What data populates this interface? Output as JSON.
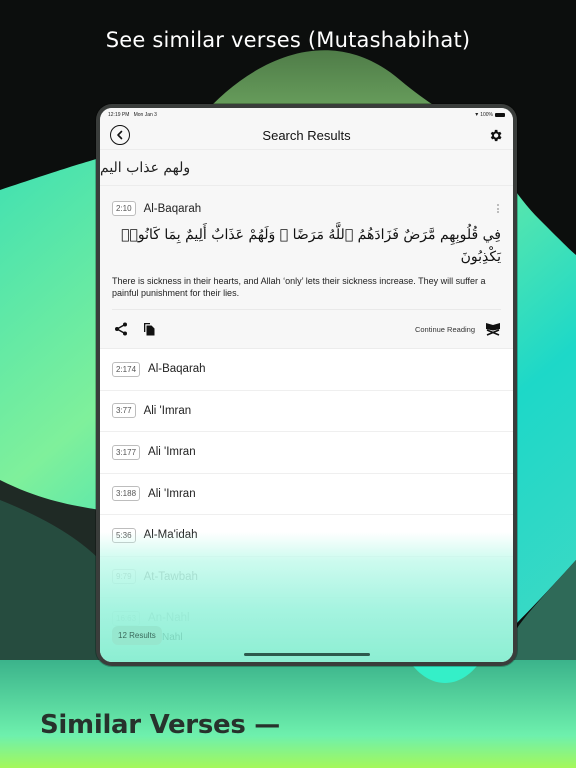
{
  "promo": {
    "title": "See similar verses (Mutashabihat)",
    "footer": "Similar Verses —"
  },
  "colors": {
    "background_dark": "#0c0e0d",
    "accent_mint": "#5ce8b8",
    "accent_teal": "#1fd6c0",
    "accent_lime": "#9cf75c",
    "footer_text": "#27322c"
  },
  "statusbar": {
    "time": "12:19 PM",
    "date": "Mon Jan 3",
    "battery": "100%",
    "wifi_icon": "wifi-icon",
    "battery_icon": "battery-icon"
  },
  "navbar": {
    "title": "Search Results",
    "back_icon": "chevron-left-circle-icon",
    "settings_icon": "gear-icon"
  },
  "query": {
    "text": "ولهم عذاب اليم"
  },
  "selected_verse": {
    "ref": "2:10",
    "surah": "Al-Baqarah",
    "arabic": "فِي قُلُوبِهِم مَّرَضٌ فَزَادَهُمُ ٱللَّهُ مَرَضًا ۖ وَلَهُمْ عَذَابٌ أَلِيمٌ بِمَا كَانُوا۟ يَكْذِبُونَ",
    "translation": "There is sickness in their hearts, and Allah ‘only’ lets their sickness increase. They will suffer a painful punishment for their lies.",
    "actions": {
      "share_icon": "share-icon",
      "copy_icon": "copy-icon",
      "continue_label": "Continue Reading",
      "continue_icon": "quran-stand-icon",
      "more_icon": "more-vertical-icon"
    }
  },
  "results": [
    {
      "ref": "2:174",
      "surah": "Al-Baqarah"
    },
    {
      "ref": "3:77",
      "surah": "Ali 'Imran"
    },
    {
      "ref": "3:177",
      "surah": "Ali 'Imran"
    },
    {
      "ref": "3:188",
      "surah": "Ali 'Imran"
    },
    {
      "ref": "5:36",
      "surah": "Al-Ma'idah"
    },
    {
      "ref": "9:79",
      "surah": "At-Tawbah"
    },
    {
      "ref": "16:63",
      "surah": "An-Nahl"
    }
  ],
  "footer": {
    "results_count": "12 Results",
    "ghost_surah": "Nahl"
  }
}
